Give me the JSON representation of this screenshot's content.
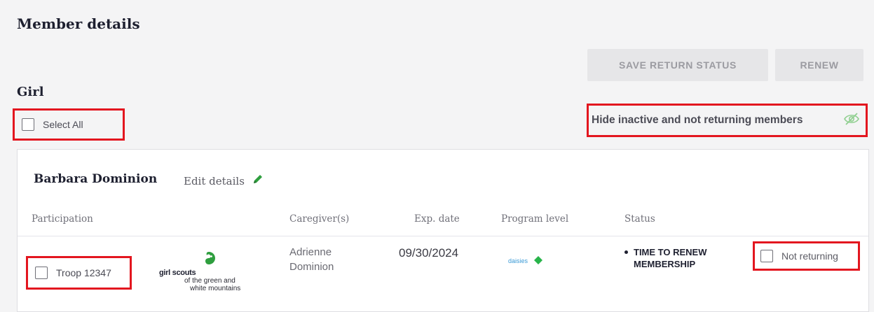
{
  "page": {
    "title": "Member details"
  },
  "actions": {
    "save_label": "SAVE RETURN STATUS",
    "renew_label": "RENEW"
  },
  "section": {
    "title": "Girl",
    "select_all_label": "Select All",
    "hide_inactive_label": "Hide inactive and not returning members"
  },
  "member": {
    "name": "Barbara Dominion",
    "edit_label": "Edit details",
    "columns": [
      "Participation",
      "Caregiver(s)",
      "Exp. date",
      "Program level",
      "Status"
    ],
    "participation": "Troop 12347",
    "council_logo": {
      "line1": "girl scouts",
      "line2": "of the green and",
      "line3": "white mountains"
    },
    "caregiver_first": "Adrienne",
    "caregiver_last": "Dominion",
    "exp_date": "09/30/2024",
    "program_level": "daisies",
    "status_line1": "TIME TO RENEW",
    "status_line2": "MEMBERSHIP",
    "not_returning_label": "Not returning"
  },
  "colors": {
    "highlight": "#e3161f",
    "accent_green": "#2e9e3e",
    "daisy_green": "#28b44a",
    "button_disabled_bg": "#e6e6e8",
    "button_disabled_text": "#9b9ba1"
  },
  "icons": {
    "edit": "pencil-icon",
    "visibility": "eye-slash-icon",
    "logo": "trefoil-icon",
    "program": "daisy-icon"
  }
}
